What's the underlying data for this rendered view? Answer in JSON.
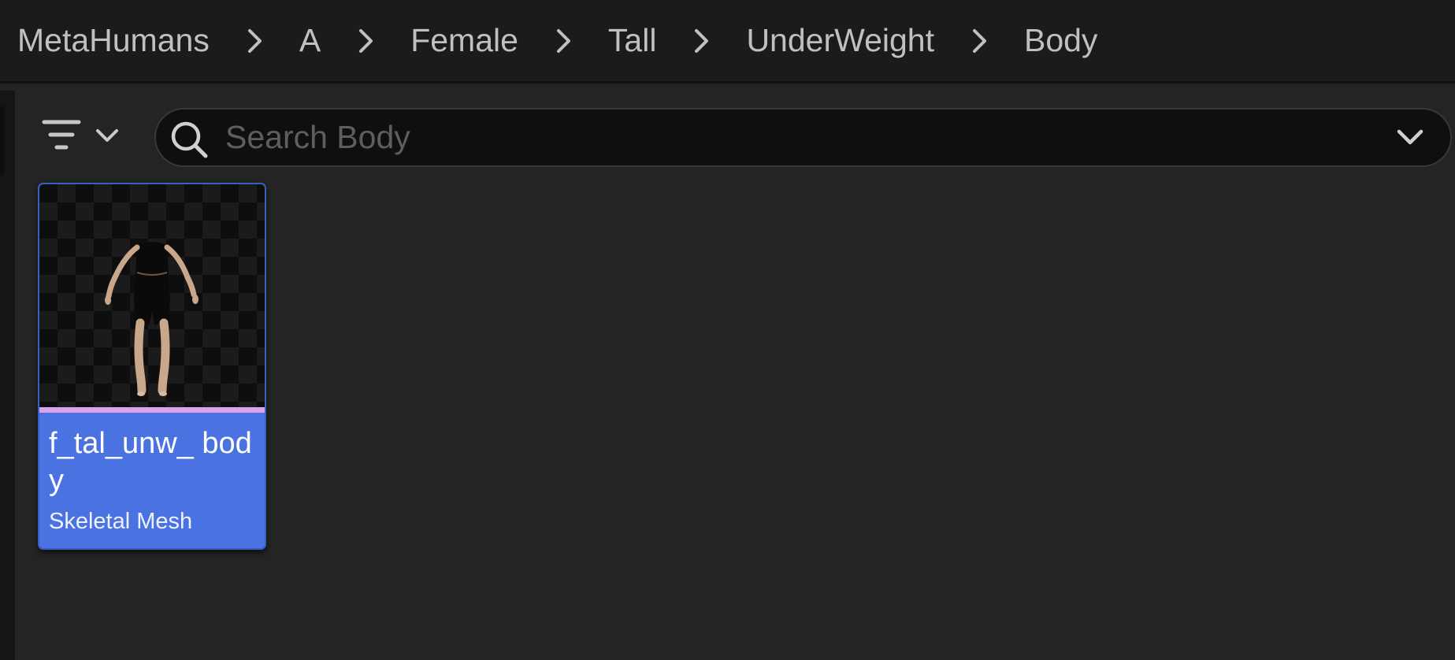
{
  "breadcrumb": {
    "items": [
      {
        "label": "MetaHumans"
      },
      {
        "label": "A"
      },
      {
        "label": "Female"
      },
      {
        "label": "Tall"
      },
      {
        "label": "UnderWeight"
      },
      {
        "label": "Body"
      }
    ],
    "separator_icon": "chevron-right-icon"
  },
  "toolbar": {
    "filter_icon": "filter-icon",
    "filter_dropdown_icon": "chevron-down-icon"
  },
  "search": {
    "placeholder": "Search Body",
    "value": "",
    "icon": "search-icon",
    "dropdown_icon": "chevron-down-icon"
  },
  "assets": [
    {
      "name": "f_tal_unw_ body",
      "type": "Skeletal Mesh",
      "selected": true,
      "type_color": "#d9a4ec",
      "thumbnail": "female-body-mesh-preview"
    }
  ],
  "colors": {
    "background": "#242424",
    "breadcrumb_bar": "#1b1b1b",
    "selection": "#4a72e0",
    "search_background": "#0f0f0f"
  }
}
